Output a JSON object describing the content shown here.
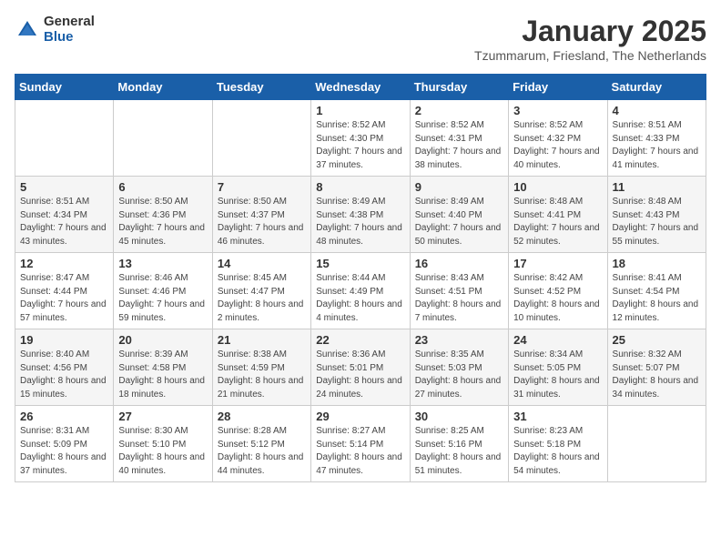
{
  "logo": {
    "general": "General",
    "blue": "Blue"
  },
  "title": "January 2025",
  "location": "Tzummarum, Friesland, The Netherlands",
  "days_of_week": [
    "Sunday",
    "Monday",
    "Tuesday",
    "Wednesday",
    "Thursday",
    "Friday",
    "Saturday"
  ],
  "weeks": [
    [
      {
        "day": "",
        "info": ""
      },
      {
        "day": "",
        "info": ""
      },
      {
        "day": "",
        "info": ""
      },
      {
        "day": "1",
        "info": "Sunrise: 8:52 AM\nSunset: 4:30 PM\nDaylight: 7 hours and 37 minutes."
      },
      {
        "day": "2",
        "info": "Sunrise: 8:52 AM\nSunset: 4:31 PM\nDaylight: 7 hours and 38 minutes."
      },
      {
        "day": "3",
        "info": "Sunrise: 8:52 AM\nSunset: 4:32 PM\nDaylight: 7 hours and 40 minutes."
      },
      {
        "day": "4",
        "info": "Sunrise: 8:51 AM\nSunset: 4:33 PM\nDaylight: 7 hours and 41 minutes."
      }
    ],
    [
      {
        "day": "5",
        "info": "Sunrise: 8:51 AM\nSunset: 4:34 PM\nDaylight: 7 hours and 43 minutes."
      },
      {
        "day": "6",
        "info": "Sunrise: 8:50 AM\nSunset: 4:36 PM\nDaylight: 7 hours and 45 minutes."
      },
      {
        "day": "7",
        "info": "Sunrise: 8:50 AM\nSunset: 4:37 PM\nDaylight: 7 hours and 46 minutes."
      },
      {
        "day": "8",
        "info": "Sunrise: 8:49 AM\nSunset: 4:38 PM\nDaylight: 7 hours and 48 minutes."
      },
      {
        "day": "9",
        "info": "Sunrise: 8:49 AM\nSunset: 4:40 PM\nDaylight: 7 hours and 50 minutes."
      },
      {
        "day": "10",
        "info": "Sunrise: 8:48 AM\nSunset: 4:41 PM\nDaylight: 7 hours and 52 minutes."
      },
      {
        "day": "11",
        "info": "Sunrise: 8:48 AM\nSunset: 4:43 PM\nDaylight: 7 hours and 55 minutes."
      }
    ],
    [
      {
        "day": "12",
        "info": "Sunrise: 8:47 AM\nSunset: 4:44 PM\nDaylight: 7 hours and 57 minutes."
      },
      {
        "day": "13",
        "info": "Sunrise: 8:46 AM\nSunset: 4:46 PM\nDaylight: 7 hours and 59 minutes."
      },
      {
        "day": "14",
        "info": "Sunrise: 8:45 AM\nSunset: 4:47 PM\nDaylight: 8 hours and 2 minutes."
      },
      {
        "day": "15",
        "info": "Sunrise: 8:44 AM\nSunset: 4:49 PM\nDaylight: 8 hours and 4 minutes."
      },
      {
        "day": "16",
        "info": "Sunrise: 8:43 AM\nSunset: 4:51 PM\nDaylight: 8 hours and 7 minutes."
      },
      {
        "day": "17",
        "info": "Sunrise: 8:42 AM\nSunset: 4:52 PM\nDaylight: 8 hours and 10 minutes."
      },
      {
        "day": "18",
        "info": "Sunrise: 8:41 AM\nSunset: 4:54 PM\nDaylight: 8 hours and 12 minutes."
      }
    ],
    [
      {
        "day": "19",
        "info": "Sunrise: 8:40 AM\nSunset: 4:56 PM\nDaylight: 8 hours and 15 minutes."
      },
      {
        "day": "20",
        "info": "Sunrise: 8:39 AM\nSunset: 4:58 PM\nDaylight: 8 hours and 18 minutes."
      },
      {
        "day": "21",
        "info": "Sunrise: 8:38 AM\nSunset: 4:59 PM\nDaylight: 8 hours and 21 minutes."
      },
      {
        "day": "22",
        "info": "Sunrise: 8:36 AM\nSunset: 5:01 PM\nDaylight: 8 hours and 24 minutes."
      },
      {
        "day": "23",
        "info": "Sunrise: 8:35 AM\nSunset: 5:03 PM\nDaylight: 8 hours and 27 minutes."
      },
      {
        "day": "24",
        "info": "Sunrise: 8:34 AM\nSunset: 5:05 PM\nDaylight: 8 hours and 31 minutes."
      },
      {
        "day": "25",
        "info": "Sunrise: 8:32 AM\nSunset: 5:07 PM\nDaylight: 8 hours and 34 minutes."
      }
    ],
    [
      {
        "day": "26",
        "info": "Sunrise: 8:31 AM\nSunset: 5:09 PM\nDaylight: 8 hours and 37 minutes."
      },
      {
        "day": "27",
        "info": "Sunrise: 8:30 AM\nSunset: 5:10 PM\nDaylight: 8 hours and 40 minutes."
      },
      {
        "day": "28",
        "info": "Sunrise: 8:28 AM\nSunset: 5:12 PM\nDaylight: 8 hours and 44 minutes."
      },
      {
        "day": "29",
        "info": "Sunrise: 8:27 AM\nSunset: 5:14 PM\nDaylight: 8 hours and 47 minutes."
      },
      {
        "day": "30",
        "info": "Sunrise: 8:25 AM\nSunset: 5:16 PM\nDaylight: 8 hours and 51 minutes."
      },
      {
        "day": "31",
        "info": "Sunrise: 8:23 AM\nSunset: 5:18 PM\nDaylight: 8 hours and 54 minutes."
      },
      {
        "day": "",
        "info": ""
      }
    ]
  ]
}
